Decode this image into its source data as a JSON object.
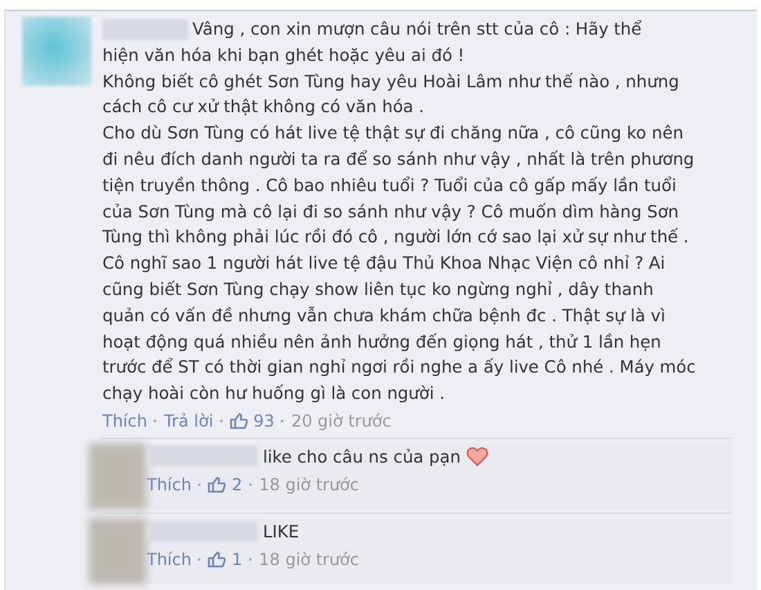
{
  "comment": {
    "lines": [
      "Vâng , con xin mượn câu nói trên stt của cô : Hãy thể",
      "hiện văn hóa khi bạn ghét hoặc yêu ai đó !",
      "Không biết cô ghét Sơn Tùng hay yêu Hoài Lâm như thế nào , nhưng",
      "cách cô cư xử thật không có văn hóa .",
      "Cho dù Sơn Tùng có hát live tệ thật sự đi chăng nữa , cô cũng ko nên",
      "đi nêu đích danh người ta ra để so sánh như vậy , nhất là trên phương",
      "tiện truyền thông . Cô bao nhiêu tuổi ? Tuổi của cô gấp mấy lần tuổi",
      "của Sơn Tùng mà cô lại đi so sánh như vậy ? Cô muốn dìm hàng Sơn",
      "Tùng thì không phải lúc rồi đó cô , người lớn cớ sao lại xử sự như thế .",
      "Cô nghĩ sao 1 người hát live tệ đậu Thủ Khoa Nhạc Viện cô nhỉ ? Ai",
      "cũng biết Sơn Tùng chạy show liên tục ko ngừng nghỉ , dây thanh",
      "quản có vấn đề nhưng vẫn chưa khám chữa bệnh đc . Thật sự là vì",
      "hoạt động quá nhiều nên ảnh hưởng đến giọng hát , thử 1 lần hẹn",
      "trước để ST có thời gian nghỉ ngơi rồi nghe a ấy live Cô nhé . Máy móc",
      "chạy hoài còn hư huống gì là con người ."
    ],
    "actions": {
      "like": "Thích",
      "reply": "Trả lời",
      "likes": "93",
      "time": "20 giờ trước"
    }
  },
  "replies": [
    {
      "text": "like cho câu ns của pạn",
      "heart": true,
      "actions": {
        "like": "Thích",
        "likes": "2",
        "time": "18 giờ trước"
      }
    },
    {
      "text": "LIKE",
      "heart": false,
      "actions": {
        "like": "Thích",
        "likes": "1",
        "time": "18 giờ trước"
      }
    }
  ]
}
